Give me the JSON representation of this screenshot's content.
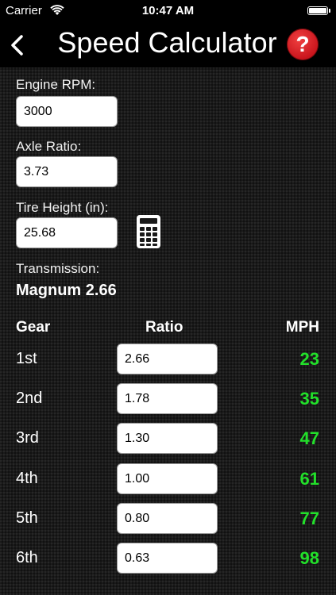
{
  "status_bar": {
    "carrier": "Carrier",
    "time": "10:47 AM"
  },
  "nav": {
    "title": "Speed Calculator",
    "help_label": "?"
  },
  "form": {
    "engine_rpm_label": "Engine RPM:",
    "engine_rpm_value": "3000",
    "axle_ratio_label": "Axle Ratio:",
    "axle_ratio_value": "3.73",
    "tire_height_label": "Tire Height (in):",
    "tire_height_value": "25.68"
  },
  "transmission": {
    "label": "Transmission:",
    "value": "Magnum 2.66"
  },
  "table": {
    "headers": {
      "gear": "Gear",
      "ratio": "Ratio",
      "mph": "MPH"
    },
    "rows": [
      {
        "gear": "1st",
        "ratio": "2.66",
        "mph": "23"
      },
      {
        "gear": "2nd",
        "ratio": "1.78",
        "mph": "35"
      },
      {
        "gear": "3rd",
        "ratio": "1.30",
        "mph": "47"
      },
      {
        "gear": "4th",
        "ratio": "1.00",
        "mph": "61"
      },
      {
        "gear": "5th",
        "ratio": "0.80",
        "mph": "77"
      },
      {
        "gear": "6th",
        "ratio": "0.63",
        "mph": "98"
      }
    ]
  },
  "colors": {
    "mph_green": "#22e02a",
    "help_red": "#d9191f",
    "background": "#1a1a1a"
  }
}
